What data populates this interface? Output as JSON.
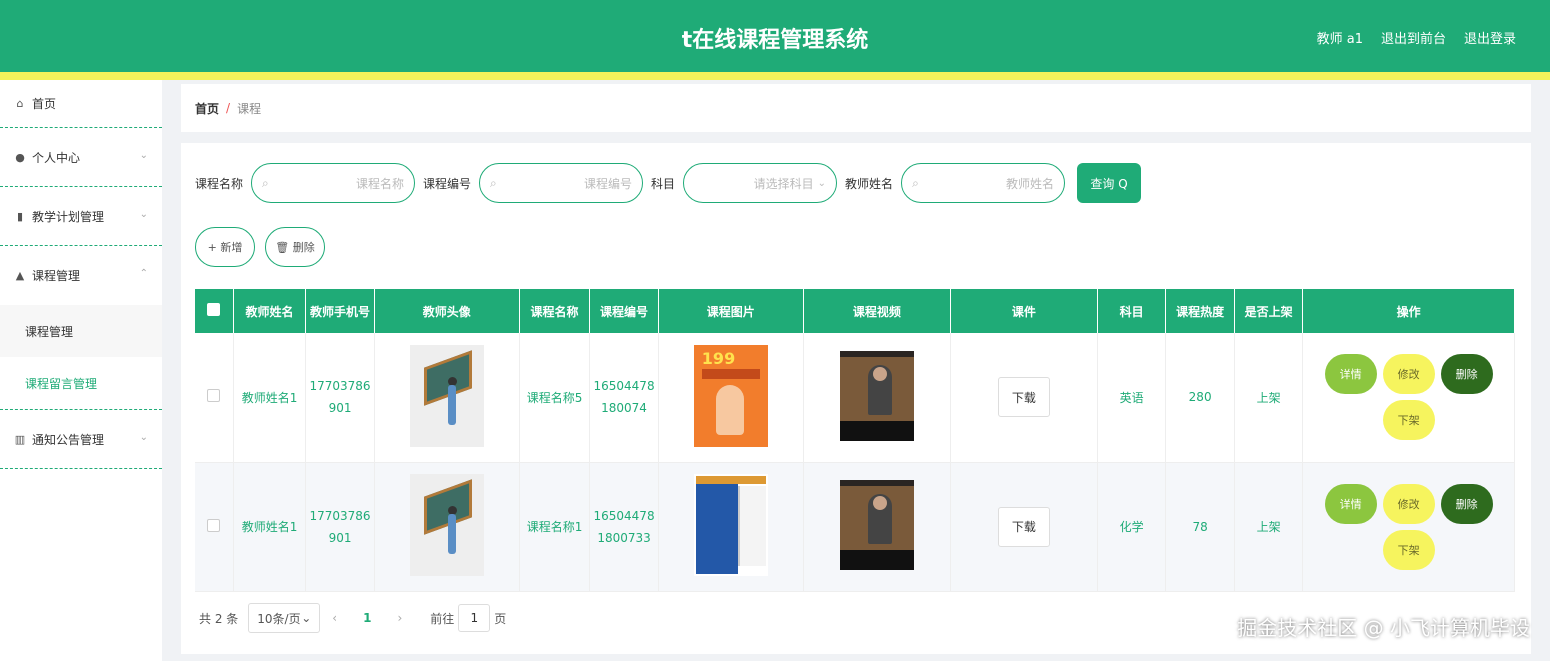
{
  "header": {
    "title": "t在线课程管理系统",
    "user": "教师 a1",
    "exit_front": "退出到前台",
    "logout": "退出登录"
  },
  "sidebar": {
    "items": [
      {
        "label": "首页",
        "icon": "home-icon"
      },
      {
        "label": "个人中心",
        "icon": "user-icon"
      },
      {
        "label": "教学计划管理",
        "icon": "clipboard-icon"
      },
      {
        "label": "课程管理",
        "icon": "thumb-icon"
      },
      {
        "label": "通知公告管理",
        "icon": "chart-icon"
      }
    ],
    "sub_items": [
      "课程管理",
      "课程留言管理"
    ]
  },
  "breadcrumb": {
    "home": "首页",
    "sep": "/",
    "current": "课程"
  },
  "search": {
    "course_name_label": "课程名称",
    "course_name_ph": "课程名称",
    "course_no_label": "课程编号",
    "course_no_ph": "课程编号",
    "subject_label": "科目",
    "subject_ph": "请选择科目",
    "teacher_label": "教师姓名",
    "teacher_ph": "教师姓名",
    "query": "查询 Q"
  },
  "actions": {
    "add": "+ 新增",
    "delete": "🗑 删除"
  },
  "table": {
    "headers": [
      "教师姓名",
      "教师手机号",
      "教师头像",
      "课程名称",
      "课程编号",
      "课程图片",
      "课程视频",
      "课件",
      "科目",
      "课程热度",
      "是否上架",
      "操作"
    ],
    "rows": [
      {
        "teacher": "教师姓名1",
        "phone1": "17703786",
        "phone2": "901",
        "course": "课程名称5",
        "no1": "16504478",
        "no2": "180074",
        "download": "下载",
        "subject": "英语",
        "heat": "280",
        "status": "上架"
      },
      {
        "teacher": "教师姓名1",
        "phone1": "17703786",
        "phone2": "901",
        "course": "课程名称1",
        "no1": "16504478",
        "no2": "1800733",
        "download": "下载",
        "subject": "化学",
        "heat": "78",
        "status": "上架"
      }
    ],
    "ops": {
      "detail": "详情",
      "edit": "修改",
      "del": "删除",
      "off": "下架"
    },
    "course1_img_text": "199"
  },
  "pager": {
    "total": "共 2 条",
    "size": "10条/页",
    "page": "1",
    "goto": "前往",
    "goto_val": "1",
    "page_unit": "页"
  },
  "watermark": "掘金技术社区 @ 小飞计算机毕设"
}
